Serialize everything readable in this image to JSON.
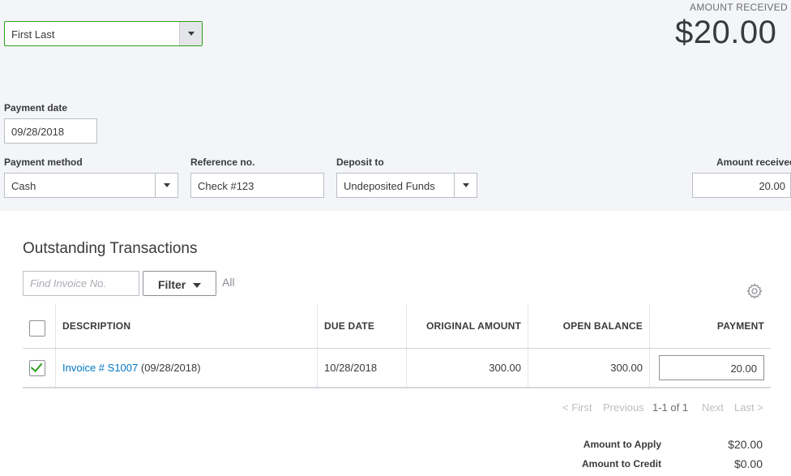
{
  "header": {
    "customer_value": "First Last",
    "amount_received_label": "AMOUNT RECEIVED",
    "amount_received_value": "$20.00"
  },
  "form": {
    "payment_date_label": "Payment date",
    "payment_date_value": "09/28/2018",
    "payment_method_label": "Payment method",
    "payment_method_value": "Cash",
    "reference_label": "Reference no.",
    "reference_value": "Check #123",
    "deposit_to_label": "Deposit to",
    "deposit_to_value": "Undeposited Funds",
    "amount_received_field_label": "Amount received",
    "amount_received_field_value": "20.00"
  },
  "outstanding": {
    "title": "Outstanding Transactions",
    "find_placeholder": "Find Invoice No.",
    "filter_label": "Filter",
    "filter_state": "All",
    "columns": {
      "description": "DESCRIPTION",
      "due_date": "DUE DATE",
      "original_amount": "ORIGINAL AMOUNT",
      "open_balance": "OPEN BALANCE",
      "payment": "PAYMENT"
    },
    "rows": [
      {
        "checked": true,
        "invoice_link": "Invoice # S1007",
        "invoice_date": "(09/28/2018)",
        "due_date": "10/28/2018",
        "original_amount": "300.00",
        "open_balance": "300.00",
        "payment": "20.00"
      }
    ]
  },
  "pagination": {
    "first": "< First",
    "previous": "Previous",
    "range": "1-1 of 1",
    "next": "Next",
    "last": "Last >"
  },
  "summary": {
    "amount_to_apply_label": "Amount to Apply",
    "amount_to_apply_value": "$20.00",
    "amount_to_credit_label": "Amount to Credit",
    "amount_to_credit_value": "$0.00"
  },
  "colors": {
    "accent_green": "#2ca01c",
    "link_blue": "#0077c5",
    "panel_bg": "#f4f5f8"
  }
}
